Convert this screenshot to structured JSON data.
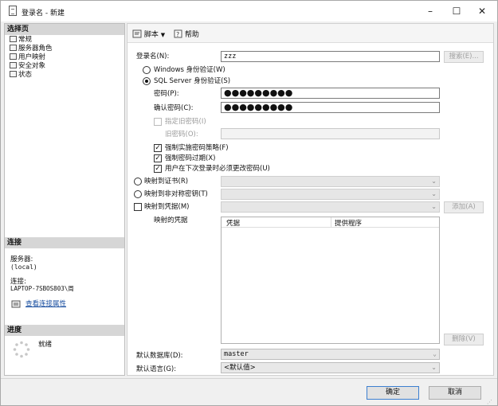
{
  "window": {
    "title": "登录名 - 新建",
    "minimize": "–",
    "maximize": "☐",
    "close": "✕"
  },
  "sidebar": {
    "select_page_header": "选择页",
    "pages": [
      {
        "label": "常规"
      },
      {
        "label": "服务器角色"
      },
      {
        "label": "用户映射"
      },
      {
        "label": "安全对象"
      },
      {
        "label": "状态"
      }
    ],
    "connection_header": "连接",
    "server_label": "服务器:",
    "server_value": "(local)",
    "connection_label": "连接:",
    "connection_value": "LAPTOP-7SBOS803\\周",
    "view_props_link": "查看连接属性",
    "progress_header": "进度",
    "progress_status": "就绪"
  },
  "toolbar": {
    "script_label": "脚本",
    "help_label": "帮助"
  },
  "form": {
    "login_name_label": "登录名(N):",
    "login_name_value": "zzz",
    "search_button": "搜索(E)...",
    "windows_auth_label": "Windows 身份验证(W)",
    "sql_auth_label": "SQL Server 身份验证(S)",
    "password_label": "密码(P):",
    "password_value": "●●●●●●●●●",
    "confirm_password_label": "确认密码(C):",
    "confirm_password_value": "●●●●●●●●●",
    "specify_old_password_label": "指定旧密码(I)",
    "old_password_label": "旧密码(O):",
    "enforce_policy_label": "强制实施密码策略(F)",
    "enforce_expiration_label": "强制密码过期(X)",
    "must_change_label": "用户在下次登录时必须更改密码(U)",
    "map_cert_label": "映射到证书(R)",
    "map_asym_key_label": "映射到非对称密钥(T)",
    "map_credential_label": "映射到凭据(M)",
    "add_button": "添加(A)",
    "mapped_credentials_label": "映射的凭据",
    "grid_col_credential": "凭据",
    "grid_col_provider": "提供程序",
    "remove_button": "删除(V)",
    "default_db_label": "默认数据库(D):",
    "default_db_value": "master",
    "default_lang_label": "默认语言(G):",
    "default_lang_value": "<默认值>"
  },
  "footer": {
    "ok_button": "确定",
    "cancel_button": "取消"
  }
}
